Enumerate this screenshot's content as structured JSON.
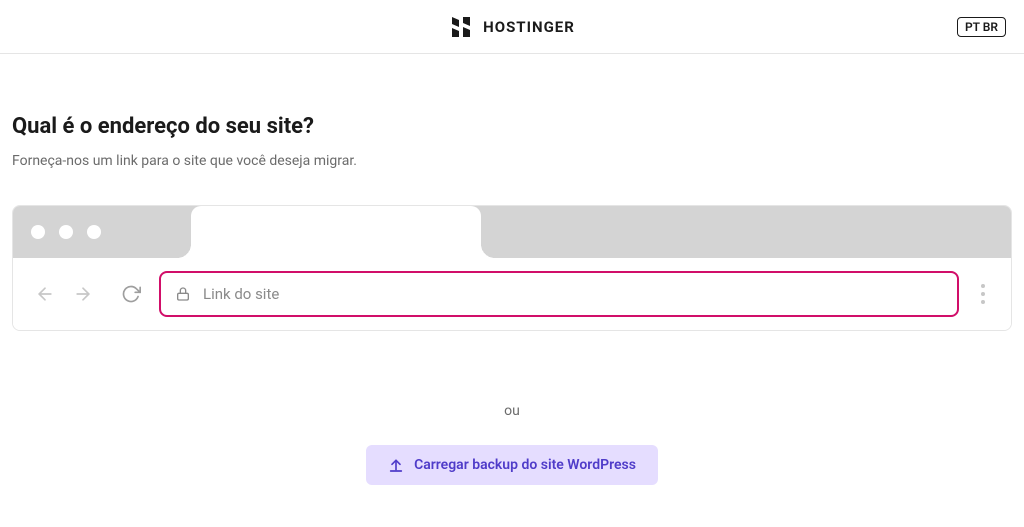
{
  "header": {
    "brand": "HOSTINGER",
    "lang_label": "PT BR"
  },
  "main": {
    "title": "Qual é o endereço do seu site?",
    "subtitle": "Forneça-nos um link para o site que você deseja migrar.",
    "url_placeholder": "Link do site",
    "or_label": "ou",
    "upload_label": "Carregar backup do site WordPress"
  },
  "icons": {
    "back": "arrow-left",
    "forward": "arrow-right",
    "reload": "reload",
    "lock": "lock",
    "menu": "vertical-dots",
    "upload": "upload"
  },
  "colors": {
    "accent_pink": "#d10e69",
    "accent_purple": "#4f3cc9",
    "accent_purple_bg": "#e5ddff",
    "tabbar_bg": "#d4d4d4"
  }
}
